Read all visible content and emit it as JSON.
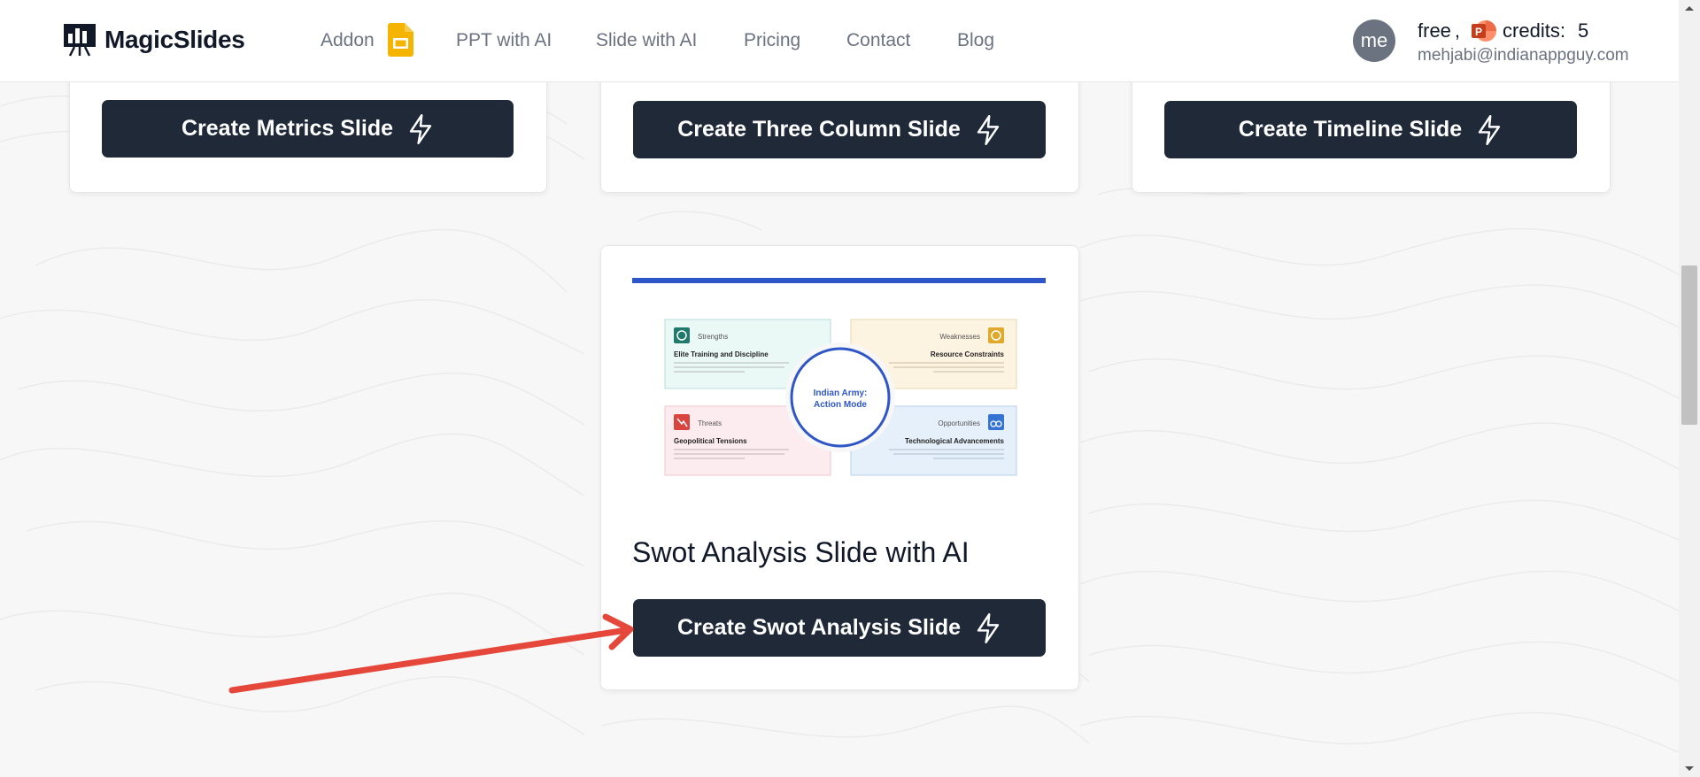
{
  "navbar": {
    "logo_text": "MagicSlides",
    "links": [
      "Addon",
      "PPT with AI",
      "Slide with AI",
      "Pricing",
      "Contact",
      "Blog"
    ],
    "avatar_initials": "me",
    "plan": "free",
    "plan_separator": ",",
    "credits_label": "credits:",
    "credits_value": "5",
    "email": "mehjabi@indianappguy.com"
  },
  "cards": {
    "metrics_button": "Create Metrics Slide",
    "three_column_button": "Create Three Column Slide",
    "timeline_button": "Create Timeline Slide",
    "swot_title": "Swot Analysis Slide with AI",
    "swot_button": "Create Swot Analysis Slide"
  },
  "swot_preview": {
    "center": [
      "Indian Army:",
      "Action Mode"
    ],
    "strengths_label": "Strengths",
    "strengths_title": "Elite Training and Discipline",
    "weaknesses_label": "Weaknesses",
    "weaknesses_title": "Resource Constraints",
    "threats_label": "Threats",
    "threats_title": "Geopolitical Tensions",
    "opportunities_label": "Opportunities",
    "opportunities_title": "Technological Advancements"
  },
  "colors": {
    "button_bg": "#1f2937",
    "accent_blue": "#2f56c9",
    "arrow_red": "#e5483b"
  }
}
